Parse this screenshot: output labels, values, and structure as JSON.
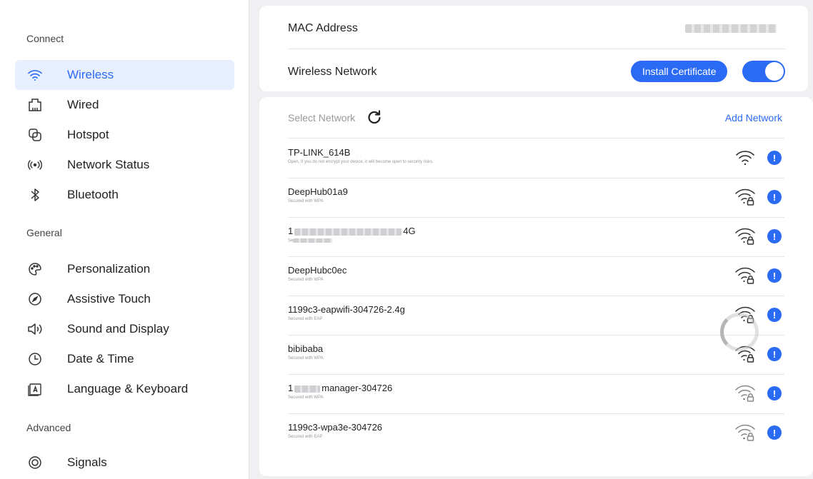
{
  "sidebar": {
    "sections": [
      {
        "label": "Connect"
      },
      {
        "label": "General"
      },
      {
        "label": "Advanced"
      }
    ],
    "items": [
      {
        "label": "Wireless",
        "icon": "wifi-icon"
      },
      {
        "label": "Wired",
        "icon": "ethernet-icon"
      },
      {
        "label": "Hotspot",
        "icon": "hotspot-icon"
      },
      {
        "label": "Network Status",
        "icon": "signal-broadcast-icon"
      },
      {
        "label": "Bluetooth",
        "icon": "bluetooth-icon"
      },
      {
        "label": "Personalization",
        "icon": "palette-icon"
      },
      {
        "label": "Assistive Touch",
        "icon": "compass-icon"
      },
      {
        "label": "Sound and Display",
        "icon": "speaker-icon"
      },
      {
        "label": "Date & Time",
        "icon": "clock-icon"
      },
      {
        "label": "Language & Keyboard",
        "icon": "keyboard-icon"
      },
      {
        "label": "Signals",
        "icon": "signals-icon"
      }
    ]
  },
  "settings": {
    "mac_label": "MAC Address",
    "wireless_label": "Wireless Network",
    "install_cert_label": "Install Certificate",
    "wireless_enabled": true
  },
  "networks_panel": {
    "select_label": "Select Network",
    "add_label": "Add Network",
    "networks": [
      {
        "name": "TP-LINK_614B",
        "subtitle": "Open, If you do not encrypt your device, it will become open to security risks.",
        "secured": false
      },
      {
        "name": "DeepHub01a9",
        "subtitle": "Secured with WPA",
        "secured": true
      },
      {
        "name_prefix": "1",
        "name_suffix": "4G",
        "subtitle_prefix": "Se",
        "secured": true
      },
      {
        "name": "DeepHubc0ec",
        "subtitle": "Secured with WPA",
        "secured": true
      },
      {
        "name": "1199c3-eapwifi-304726-2.4g",
        "subtitle": "Secured with EAP",
        "secured": true
      },
      {
        "name": "bibibaba",
        "subtitle": "Secured with WPA",
        "secured": true
      },
      {
        "name_prefix": "1",
        "name_suffix": "manager-304726",
        "subtitle": "Secured with WPA",
        "secured": true
      },
      {
        "name": "1199c3-wpa3e-304726",
        "subtitle": "Secured with EAP",
        "secured": true
      }
    ]
  },
  "colors": {
    "accent": "#2b6bf3",
    "active_bg": "#e8efff"
  }
}
